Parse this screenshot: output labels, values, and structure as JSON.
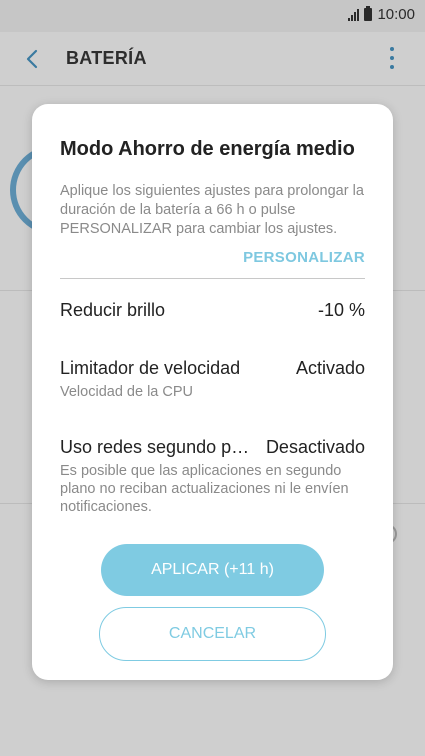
{
  "status_bar": {
    "time": "10:00",
    "icons": [
      "signal-icon",
      "battery-icon"
    ]
  },
  "app_bar": {
    "title": "BATERÍA",
    "icons": [
      "back-arrow-icon",
      "more-options-icon"
    ]
  },
  "dialog": {
    "title": "Modo Ahorro de energía medio",
    "description": "Aplique los siguientes ajustes para prolongar la duración de la batería a 66 h o pulse PERSONALIZAR para cambiar los ajustes.",
    "customize_link": "PERSONALIZAR",
    "settings": [
      {
        "label": "Reducir brillo",
        "value": "-10 %",
        "sub": ""
      },
      {
        "label": "Limitador de velocidad",
        "value": "Activado",
        "sub": "Velocidad de la CPU"
      },
      {
        "label": "Uso redes segundo p…",
        "value": "Desactivado",
        "sub": "Es posible que las aplicaciones en segundo plano no reciban actualizaciones ni le envíen notificaciones."
      }
    ],
    "apply_button": "APLICAR (+11 h)",
    "cancel_button": "CANCELAR"
  },
  "colors": {
    "accent": "#7fcbe2",
    "accent_dark": "#3a7aa0",
    "scrim_background": "#cfcfcf"
  }
}
